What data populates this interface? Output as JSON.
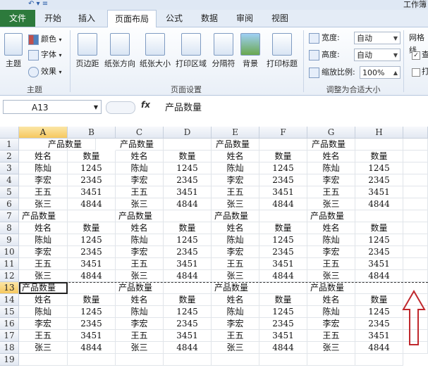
{
  "window": {
    "title": "工作簿"
  },
  "tabs": [
    {
      "label": "文件",
      "name": "tab-file"
    },
    {
      "label": "开始",
      "name": "tab-home"
    },
    {
      "label": "插入",
      "name": "tab-insert"
    },
    {
      "label": "页面布局",
      "name": "tab-page-layout"
    },
    {
      "label": "公式",
      "name": "tab-formulas"
    },
    {
      "label": "数据",
      "name": "tab-data"
    },
    {
      "label": "审阅",
      "name": "tab-review"
    },
    {
      "label": "视图",
      "name": "tab-view"
    }
  ],
  "ribbon": {
    "theme": {
      "themes": "主题",
      "colors": "颜色",
      "fonts": "字体",
      "effects": "效果",
      "group": "主题"
    },
    "page_setup": {
      "margins": "页边距",
      "orientation": "纸张方向",
      "size": "纸张大小",
      "print_area": "打印区域",
      "breaks": "分隔符",
      "background": "背景",
      "print_titles": "打印标题",
      "group": "页面设置"
    },
    "scale": {
      "width_label": "宽度:",
      "width_value": "自动",
      "height_label": "高度:",
      "height_value": "自动",
      "scale_label": "缩放比例:",
      "scale_value": "100%",
      "group": "调整为合适大小"
    },
    "sheet_options": {
      "gridlines": "网格线",
      "view_short": "查",
      "print_short": "打"
    }
  },
  "formula_bar": {
    "cell_ref": "A13",
    "fx": "fx",
    "value": "产品数量"
  },
  "columns": [
    "A",
    "B",
    "C",
    "D",
    "E",
    "F",
    "G",
    "H"
  ],
  "rows": [
    "1",
    "2",
    "3",
    "4",
    "5",
    "6",
    "7",
    "8",
    "9",
    "10",
    "11",
    "12",
    "13",
    "14",
    "15",
    "16",
    "17",
    "18",
    "19"
  ],
  "sheet": {
    "title_label": "产品数量",
    "header_name": "姓名",
    "header_qty": "数量",
    "blocks": [
      {
        "title_row": [
          "",
          "产品数量",
          "产品数量",
          "",
          "产品数量",
          "",
          "产品数量",
          ""
        ],
        "header_row": [
          "姓名",
          "数量",
          "姓名",
          "数量",
          "姓名",
          "数量",
          "姓名",
          "数量"
        ],
        "data": [
          [
            "陈灿",
            "1245",
            "陈灿",
            "1245",
            "陈灿",
            "1245",
            "陈灿",
            "1245"
          ],
          [
            "李宏",
            "2345",
            "李宏",
            "2345",
            "李宏",
            "2345",
            "李宏",
            "2345"
          ],
          [
            "王五",
            "3451",
            "王五",
            "3451",
            "王五",
            "3451",
            "王五",
            "3451"
          ],
          [
            "张三",
            "4844",
            "张三",
            "4844",
            "张三",
            "4844",
            "张三",
            "4844"
          ]
        ]
      },
      {
        "title_row": [
          "产品数量",
          "",
          "产品数量",
          "",
          "产品数量",
          "",
          "产品数量",
          ""
        ],
        "header_row": [
          "姓名",
          "数量",
          "姓名",
          "数量",
          "姓名",
          "数量",
          "姓名",
          "数量"
        ],
        "data": [
          [
            "陈灿",
            "1245",
            "陈灿",
            "1245",
            "陈灿",
            "1245",
            "陈灿",
            "1245"
          ],
          [
            "李宏",
            "2345",
            "李宏",
            "2345",
            "李宏",
            "2345",
            "李宏",
            "2345"
          ],
          [
            "王五",
            "3451",
            "王五",
            "3451",
            "王五",
            "3451",
            "王五",
            "3451"
          ],
          [
            "张三",
            "4844",
            "张三",
            "4844",
            "张三",
            "4844",
            "张三",
            "4844"
          ]
        ]
      },
      {
        "title_row": [
          "产品数量",
          "",
          "产品数量",
          "",
          "产品数量",
          "",
          "产品数量",
          ""
        ],
        "header_row": [
          "姓名",
          "数量",
          "姓名",
          "数量",
          "姓名",
          "数量",
          "姓名",
          "数量"
        ],
        "data": [
          [
            "陈灿",
            "1245",
            "陈灿",
            "1245",
            "陈灿",
            "1245",
            "陈灿",
            "1245"
          ],
          [
            "李宏",
            "2345",
            "李宏",
            "2345",
            "李宏",
            "2345",
            "李宏",
            "2345"
          ],
          [
            "王五",
            "3451",
            "王五",
            "3451",
            "王五",
            "3451",
            "王五",
            "3451"
          ],
          [
            "张三",
            "4844",
            "张三",
            "4844",
            "张三",
            "4844",
            "张三",
            "4844"
          ]
        ]
      }
    ]
  },
  "selection": {
    "column": "A",
    "row": "13"
  },
  "colors": {
    "file_tab": "#2d7a3c",
    "selected_header": "#f6c85f",
    "arrow": "#c0282d"
  },
  "icons": [
    "themes-icon",
    "colors-icon",
    "fonts-icon",
    "effects-icon",
    "margins-icon",
    "orientation-icon",
    "size-icon",
    "print-area-icon",
    "breaks-icon",
    "background-icon",
    "print-titles-icon",
    "dropdown-arrow-icon",
    "red-up-arrow-icon"
  ]
}
